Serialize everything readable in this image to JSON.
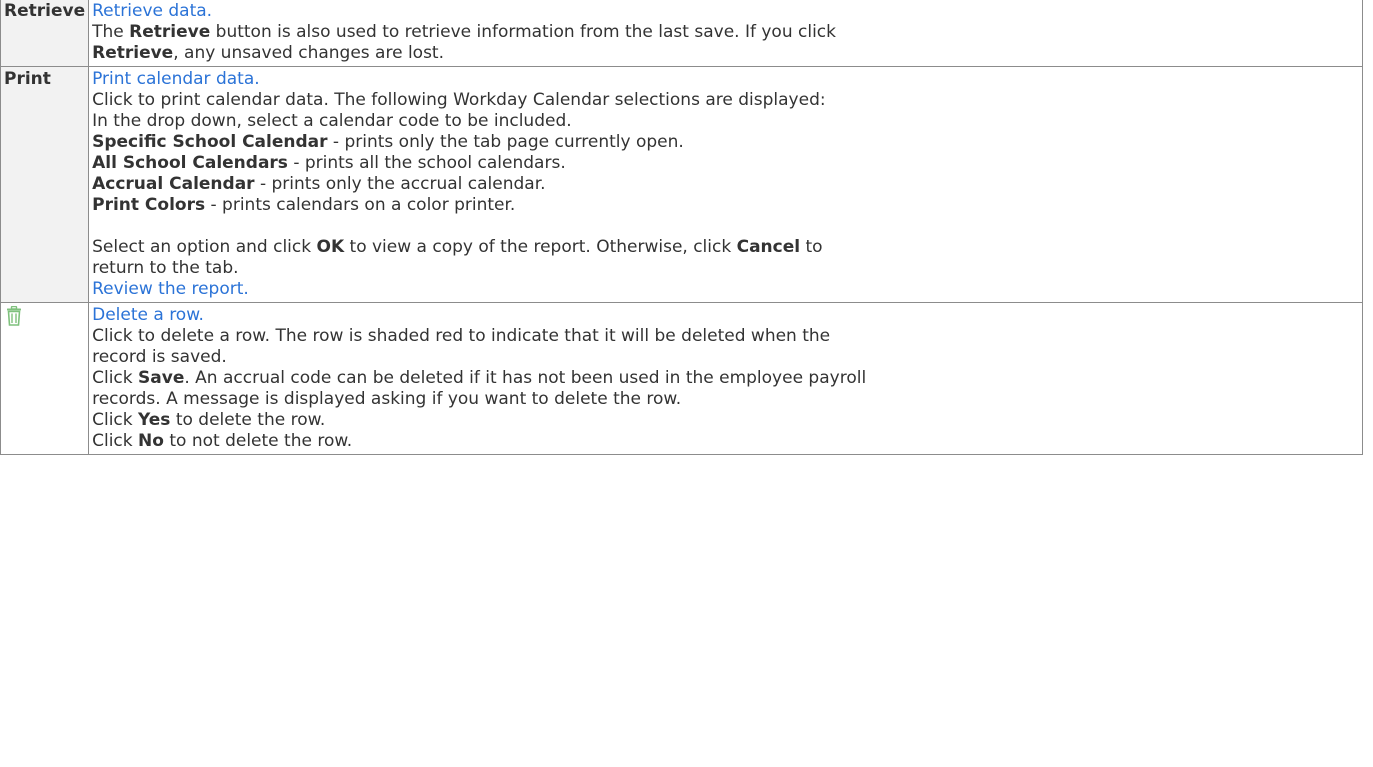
{
  "rows": [
    {
      "label": "Retrieve",
      "link": "Retrieve data.",
      "desc": [
        {
          "pre": "The ",
          "b1": "Retrieve",
          "post": " button is also used to retrieve information from the last save. If you click"
        },
        {
          "b1": "Retrieve",
          "post": ", any unsaved changes are lost."
        }
      ]
    },
    {
      "label": "Print",
      "link": "Print calendar data.",
      "intro": "Click to print calendar data. The following Workday Calendar selections are displayed:",
      "dropdown": "In the drop down, select a calendar code to be included.",
      "options": [
        {
          "name": "Specific School Calendar",
          "text": " - prints only the tab page currently open."
        },
        {
          "name": "All School Calendars",
          "text": " - prints all the school calendars."
        },
        {
          "name": "Accrual Calendar",
          "text": " - prints only the accrual calendar."
        },
        {
          "name": "Print Colors",
          "text": " - prints calendars on a color printer."
        }
      ],
      "select": {
        "pre": "Select an option and click ",
        "ok": "OK",
        "mid": " to view a copy of the report. Otherwise, click ",
        "cancel": "Cancel",
        "post": " to"
      },
      "select2": "return to the tab.",
      "review": "Review the report."
    },
    {
      "icon": "trash-icon",
      "link": "Delete a row.",
      "l1": "Click to delete a row. The row is shaded red to indicate that it will be deleted when the",
      "l2": "record is saved.",
      "l3": {
        "pre": "Click ",
        "b": "Save",
        "post": ". An accrual code can be deleted if it has not been used in the employee payroll"
      },
      "l4": "records. A message is displayed asking if you want to delete the row.",
      "l5": {
        "pre": "Click ",
        "b": "Yes",
        "post": " to delete the row."
      },
      "l6": {
        "pre": "Click ",
        "b": "No",
        "post": " to not delete the row."
      }
    }
  ],
  "colors": {
    "link": "#2b73d7",
    "text": "#333333",
    "border": "#8c8c8c",
    "label_bg": "#f2f2f2",
    "icon": "#7fc17d"
  }
}
